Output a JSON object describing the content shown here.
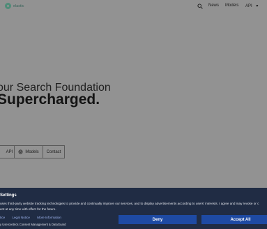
{
  "header": {
    "logo_text": "elastic",
    "nav": {
      "news": "News",
      "models": "Models",
      "api": "API",
      "api_caret": "▾"
    }
  },
  "hero": {
    "line1": "our Search Foundation",
    "line2": "Supercharged."
  },
  "buttons": {
    "api": "API",
    "models": "Models",
    "contact": "Contact"
  },
  "consent": {
    "title": "Settings",
    "text_line1": "uses third-party website tracking technologies to provide and continually improve our services, and to display advertisements according to users' interests. I agree and may revoke or c",
    "text_line2": "ent at any time with effect for the future.",
    "links": [
      "tice",
      "Legal Notice",
      "More Information"
    ],
    "powered_by": "y Usercentrics Consent Management & DataGuard",
    "deny_label": "Deny",
    "accept_label": "Accept All"
  },
  "colors": {
    "overlay_gray": "#929292",
    "consent_bg": "#202c44",
    "button_blue": "#1e4aa3",
    "link_blue": "#9fb6f0"
  }
}
